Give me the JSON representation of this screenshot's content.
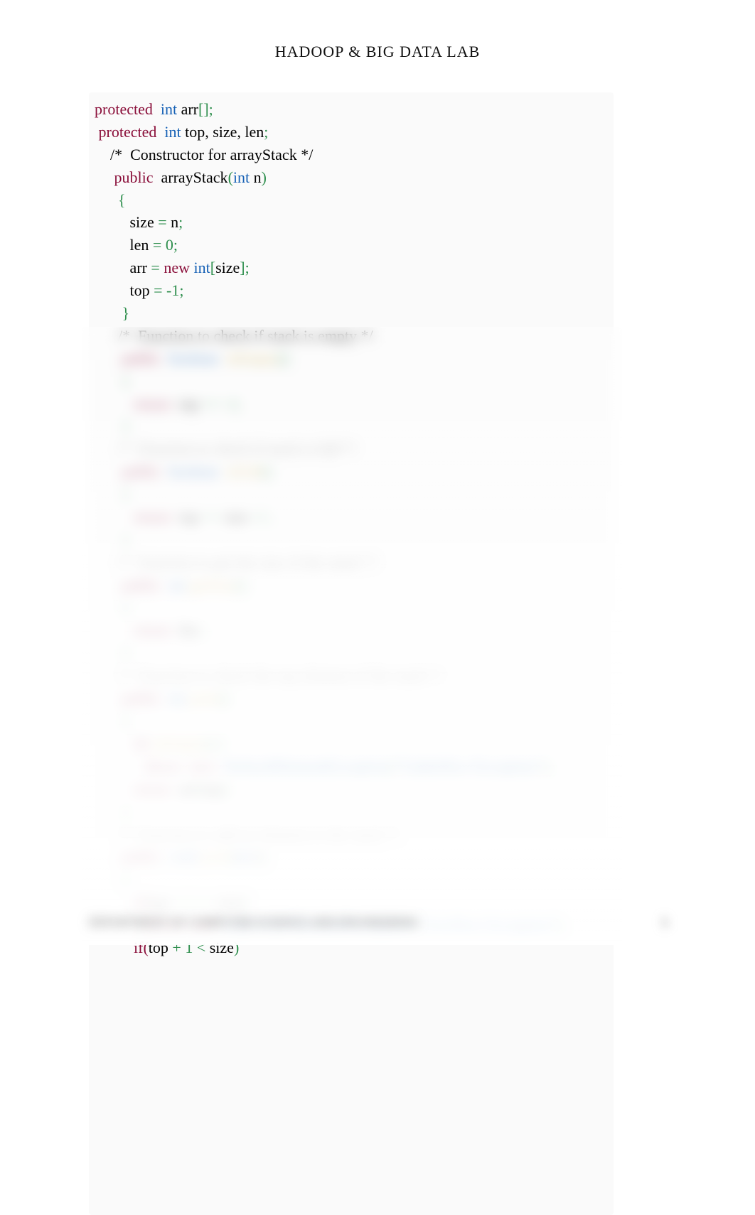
{
  "header": {
    "title": "HADOOP & BIG DATA LAB"
  },
  "code": {
    "lines": [
      {
        "tokens": [
          {
            "t": "protected ",
            "c": "kw"
          },
          {
            "t": " ",
            "c": "plain"
          },
          {
            "t": "int ",
            "c": "type"
          },
          {
            "t": "arr",
            "c": "plain"
          },
          {
            "t": "[];",
            "c": "pun"
          }
        ]
      },
      {
        "tokens": [
          {
            "t": " protected ",
            "c": "kw"
          },
          {
            "t": " ",
            "c": "plain"
          },
          {
            "t": "int ",
            "c": "type"
          },
          {
            "t": "top, size, len",
            "c": "plain"
          },
          {
            "t": ";",
            "c": "pun"
          }
        ]
      },
      {
        "tokens": [
          {
            "t": "    /*  Constructor for arrayStack */",
            "c": "plain"
          }
        ]
      },
      {
        "tokens": [
          {
            "t": "     ",
            "c": "plain"
          },
          {
            "t": "public ",
            "c": "kw"
          },
          {
            "t": " arrayStack",
            "c": "plain"
          },
          {
            "t": "(",
            "c": "pun"
          },
          {
            "t": "int ",
            "c": "type"
          },
          {
            "t": "n",
            "c": "plain"
          },
          {
            "t": ")",
            "c": "pun"
          }
        ]
      },
      {
        "tokens": [
          {
            "t": "      ",
            "c": "plain"
          },
          {
            "t": "{",
            "c": "pun"
          }
        ]
      },
      {
        "tokens": [
          {
            "t": "         size ",
            "c": "plain"
          },
          {
            "t": "=",
            "c": "pun"
          },
          {
            "t": " n",
            "c": "plain"
          },
          {
            "t": ";",
            "c": "pun"
          }
        ]
      },
      {
        "tokens": [
          {
            "t": "         len ",
            "c": "plain"
          },
          {
            "t": "= ",
            "c": "pun"
          },
          {
            "t": "0",
            "c": "lit"
          },
          {
            "t": ";",
            "c": "pun"
          }
        ]
      },
      {
        "tokens": [
          {
            "t": "         arr ",
            "c": "plain"
          },
          {
            "t": "= ",
            "c": "pun"
          },
          {
            "t": "new ",
            "c": "kw"
          },
          {
            "t": "int",
            "c": "type"
          },
          {
            "t": "[",
            "c": "pun"
          },
          {
            "t": "size",
            "c": "plain"
          },
          {
            "t": "];",
            "c": "pun"
          }
        ]
      },
      {
        "tokens": [
          {
            "t": "         top ",
            "c": "plain"
          },
          {
            "t": "= -",
            "c": "pun"
          },
          {
            "t": "1",
            "c": "lit"
          },
          {
            "t": ";",
            "c": "pun"
          }
        ]
      },
      {
        "tokens": [
          {
            "t": "       ",
            "c": "plain"
          },
          {
            "t": "}",
            "c": "pun"
          }
        ]
      },
      {
        "tokens": [
          {
            "t": "      /*  Function to check if stack is empty */",
            "c": "plain"
          }
        ]
      },
      {
        "tokens": [
          {
            "t": "       ",
            "c": "plain"
          },
          {
            "t": "public ",
            "c": "kw"
          },
          {
            "t": " ",
            "c": "plain"
          },
          {
            "t": "boolean ",
            "c": "type"
          },
          {
            "t": " ",
            "c": "plain"
          },
          {
            "t": "isEmpty",
            "c": "fn"
          },
          {
            "t": "()",
            "c": "pun"
          }
        ]
      },
      {
        "tokens": [
          {
            "t": "       ",
            "c": "plain"
          },
          {
            "t": "{",
            "c": "pun"
          }
        ]
      },
      {
        "tokens": [
          {
            "t": "          ",
            "c": "plain"
          },
          {
            "t": "return ",
            "c": "kw"
          },
          {
            "t": " top ",
            "c": "plain"
          },
          {
            "t": "== -",
            "c": "pun"
          },
          {
            "t": "1",
            "c": "lit"
          },
          {
            "t": ";",
            "c": "pun"
          }
        ]
      },
      {
        "tokens": [
          {
            "t": "       ",
            "c": "plain"
          },
          {
            "t": "}",
            "c": "pun"
          }
        ]
      },
      {
        "tokens": [
          {
            "t": "      /*  Function to check if stack is full */",
            "c": "cmt"
          }
        ]
      },
      {
        "tokens": [
          {
            "t": "       ",
            "c": "plain"
          },
          {
            "t": "public ",
            "c": "kw"
          },
          {
            "t": " ",
            "c": "plain"
          },
          {
            "t": "boolean ",
            "c": "type"
          },
          {
            "t": " ",
            "c": "plain"
          },
          {
            "t": "isFull",
            "c": "fn"
          },
          {
            "t": "()",
            "c": "pun"
          }
        ]
      },
      {
        "tokens": [
          {
            "t": "       ",
            "c": "plain"
          },
          {
            "t": "{",
            "c": "pun"
          }
        ]
      },
      {
        "tokens": [
          {
            "t": "          ",
            "c": "plain"
          },
          {
            "t": "return ",
            "c": "kw"
          },
          {
            "t": " top ",
            "c": "plain"
          },
          {
            "t": "==",
            "c": "pun"
          },
          {
            "t": " size ",
            "c": "plain"
          },
          {
            "t": "-",
            "c": "pun"
          },
          {
            "t": "1",
            "c": "lit"
          },
          {
            "t": " ;",
            "c": "pun"
          }
        ]
      },
      {
        "tokens": [
          {
            "t": "       ",
            "c": "plain"
          },
          {
            "t": "}",
            "c": "pun"
          }
        ]
      },
      {
        "tokens": [
          {
            "t": "      /*  Function to get the size of the stack */",
            "c": "cmt"
          }
        ]
      },
      {
        "tokens": [
          {
            "t": "       ",
            "c": "plain"
          },
          {
            "t": "public ",
            "c": "kw"
          },
          {
            "t": " ",
            "c": "plain"
          },
          {
            "t": "int ",
            "c": "type"
          },
          {
            "t": "getSize",
            "c": "fn"
          },
          {
            "t": "()",
            "c": "pun"
          }
        ]
      },
      {
        "tokens": [
          {
            "t": "       ",
            "c": "plain"
          },
          {
            "t": "{",
            "c": "pun"
          }
        ]
      },
      {
        "tokens": [
          {
            "t": "          ",
            "c": "plain"
          },
          {
            "t": "return ",
            "c": "kw"
          },
          {
            "t": " len ",
            "c": "plain"
          },
          {
            "t": ";",
            "c": "pun"
          }
        ]
      },
      {
        "tokens": [
          {
            "t": "       ",
            "c": "plain"
          },
          {
            "t": "}",
            "c": "pun"
          }
        ]
      },
      {
        "tokens": [
          {
            "t": "      /*  Function to check the top element of the stack */",
            "c": "cmt"
          }
        ]
      },
      {
        "tokens": [
          {
            "t": "       ",
            "c": "plain"
          },
          {
            "t": "public ",
            "c": "kw"
          },
          {
            "t": " ",
            "c": "plain"
          },
          {
            "t": "int ",
            "c": "type"
          },
          {
            "t": "peek",
            "c": "fn"
          },
          {
            "t": "()",
            "c": "pun"
          }
        ]
      },
      {
        "tokens": [
          {
            "t": "       ",
            "c": "plain"
          },
          {
            "t": "{",
            "c": "pun"
          }
        ]
      },
      {
        "tokens": [
          {
            "t": "          ",
            "c": "plain"
          },
          {
            "t": "if( ",
            "c": "kw"
          },
          {
            "t": "isEmpty",
            "c": "fn"
          },
          {
            "t": "() )",
            "c": "pun"
          }
        ]
      },
      {
        "tokens": [
          {
            "t": "             ",
            "c": "plain"
          },
          {
            "t": "throw ",
            "c": "kw"
          },
          {
            "t": " ",
            "c": "plain"
          },
          {
            "t": "new ",
            "c": "kw"
          },
          {
            "t": " ",
            "c": "plain"
          },
          {
            "t": "NoSuchElementException",
            "c": "cls"
          },
          {
            "t": "(",
            "c": "pun"
          },
          {
            "t": "\"Underflow Exception\"",
            "c": "str"
          },
          {
            "t": ");",
            "c": "pun"
          }
        ]
      },
      {
        "tokens": [
          {
            "t": "          ",
            "c": "plain"
          },
          {
            "t": "return ",
            "c": "kw"
          },
          {
            "t": " arr",
            "c": "plain"
          },
          {
            "t": "[",
            "c": "pun"
          },
          {
            "t": "top",
            "c": "plain"
          },
          {
            "t": "];",
            "c": "pun"
          }
        ]
      },
      {
        "tokens": [
          {
            "t": "       ",
            "c": "plain"
          },
          {
            "t": "}",
            "c": "pun"
          }
        ]
      },
      {
        "tokens": [
          {
            "t": "      /*  Function to add an element to the stack */",
            "c": "cmt"
          }
        ]
      },
      {
        "tokens": [
          {
            "t": "       ",
            "c": "plain"
          },
          {
            "t": "public ",
            "c": "kw"
          },
          {
            "t": " ",
            "c": "plain"
          },
          {
            "t": "void ",
            "c": "type"
          },
          {
            "t": "push",
            "c": "fn"
          },
          {
            "t": "(",
            "c": "pun"
          },
          {
            "t": "int ",
            "c": "type"
          },
          {
            "t": "i",
            "c": "plain"
          },
          {
            "t": ")",
            "c": "pun"
          }
        ]
      },
      {
        "tokens": [
          {
            "t": "       ",
            "c": "plain"
          },
          {
            "t": "{",
            "c": "pun"
          }
        ]
      },
      {
        "tokens": [
          {
            "t": "          ",
            "c": "plain"
          },
          {
            "t": "if(",
            "c": "kw"
          },
          {
            "t": "top ",
            "c": "plain"
          },
          {
            "t": "+ ",
            "c": "pun"
          },
          {
            "t": "1 ",
            "c": "lit"
          },
          {
            "t": ">=",
            "c": "pun"
          },
          {
            "t": " size",
            "c": "plain"
          },
          {
            "t": ")",
            "c": "pun"
          }
        ]
      },
      {
        "tokens": [
          {
            "t": "             ",
            "c": "plain"
          },
          {
            "t": "throw ",
            "c": "kw"
          },
          {
            "t": " ",
            "c": "plain"
          },
          {
            "t": "new ",
            "c": "kw"
          },
          {
            "t": " ",
            "c": "plain"
          },
          {
            "t": "IndexOutOfBoundsException",
            "c": "cls"
          },
          {
            "t": "(",
            "c": "pun"
          },
          {
            "t": "\"Overflow Exception\"",
            "c": "str"
          },
          {
            "t": ");",
            "c": "pun"
          }
        ]
      },
      {
        "tokens": [
          {
            "t": "          ",
            "c": "plain"
          },
          {
            "t": "if(",
            "c": "kw"
          },
          {
            "t": "top ",
            "c": "plain"
          },
          {
            "t": "+ ",
            "c": "pun"
          },
          {
            "t": "1 ",
            "c": "lit"
          },
          {
            "t": "<",
            "c": "pun"
          },
          {
            "t": " size",
            "c": "plain"
          },
          {
            "t": ")",
            "c": "pun"
          }
        ]
      }
    ]
  },
  "footer": {
    "text": "DEPARTMENT OF COMPUTER SCIENCE AND ENGINEERING",
    "page_number": "5"
  }
}
